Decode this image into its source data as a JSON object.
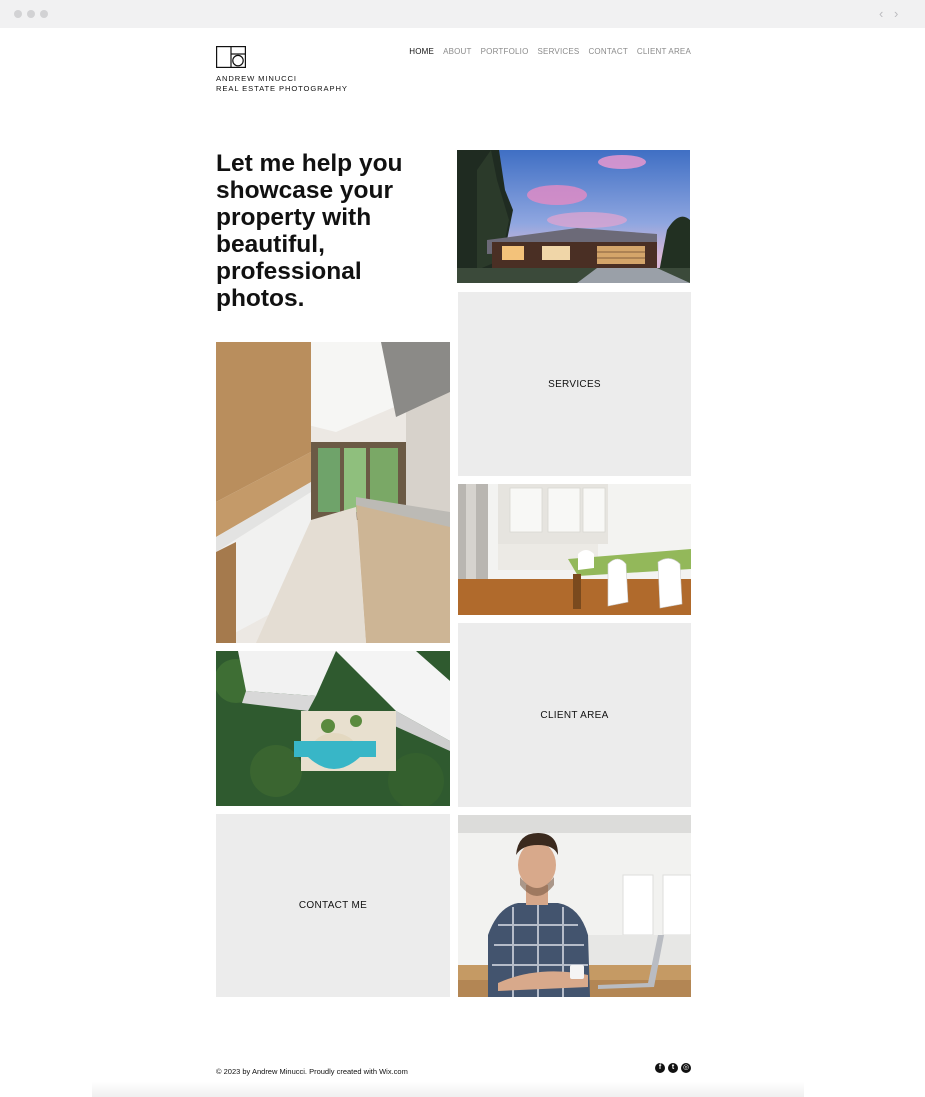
{
  "browser": {
    "back_icon": "chevron-left-icon",
    "forward_icon": "chevron-right-icon"
  },
  "header": {
    "brand_line1": "ANDREW MINUCCI",
    "brand_line2": "REAL ESTATE PHOTOGRAPHY",
    "nav": [
      {
        "label": "HOME",
        "active": true
      },
      {
        "label": "ABOUT"
      },
      {
        "label": "PORTFOLIO"
      },
      {
        "label": "SERVICES"
      },
      {
        "label": "CONTACT"
      },
      {
        "label": "CLIENT AREA"
      }
    ]
  },
  "hero": {
    "headline": "Let me help you showcase your property with beautiful, professional photos."
  },
  "tiles": {
    "services_label": "SERVICES",
    "client_area_label": "CLIENT AREA",
    "contact_label": "CONTACT ME"
  },
  "footer": {
    "copyright": "© 2023 by Andrew Minucci. Proudly created with Wix.com",
    "socials": [
      "facebook-icon",
      "twitter-icon",
      "instagram-icon"
    ]
  },
  "colors": {
    "tile_grey": "#ececec",
    "nav_inactive": "#8a8a8a",
    "text": "#111111"
  }
}
